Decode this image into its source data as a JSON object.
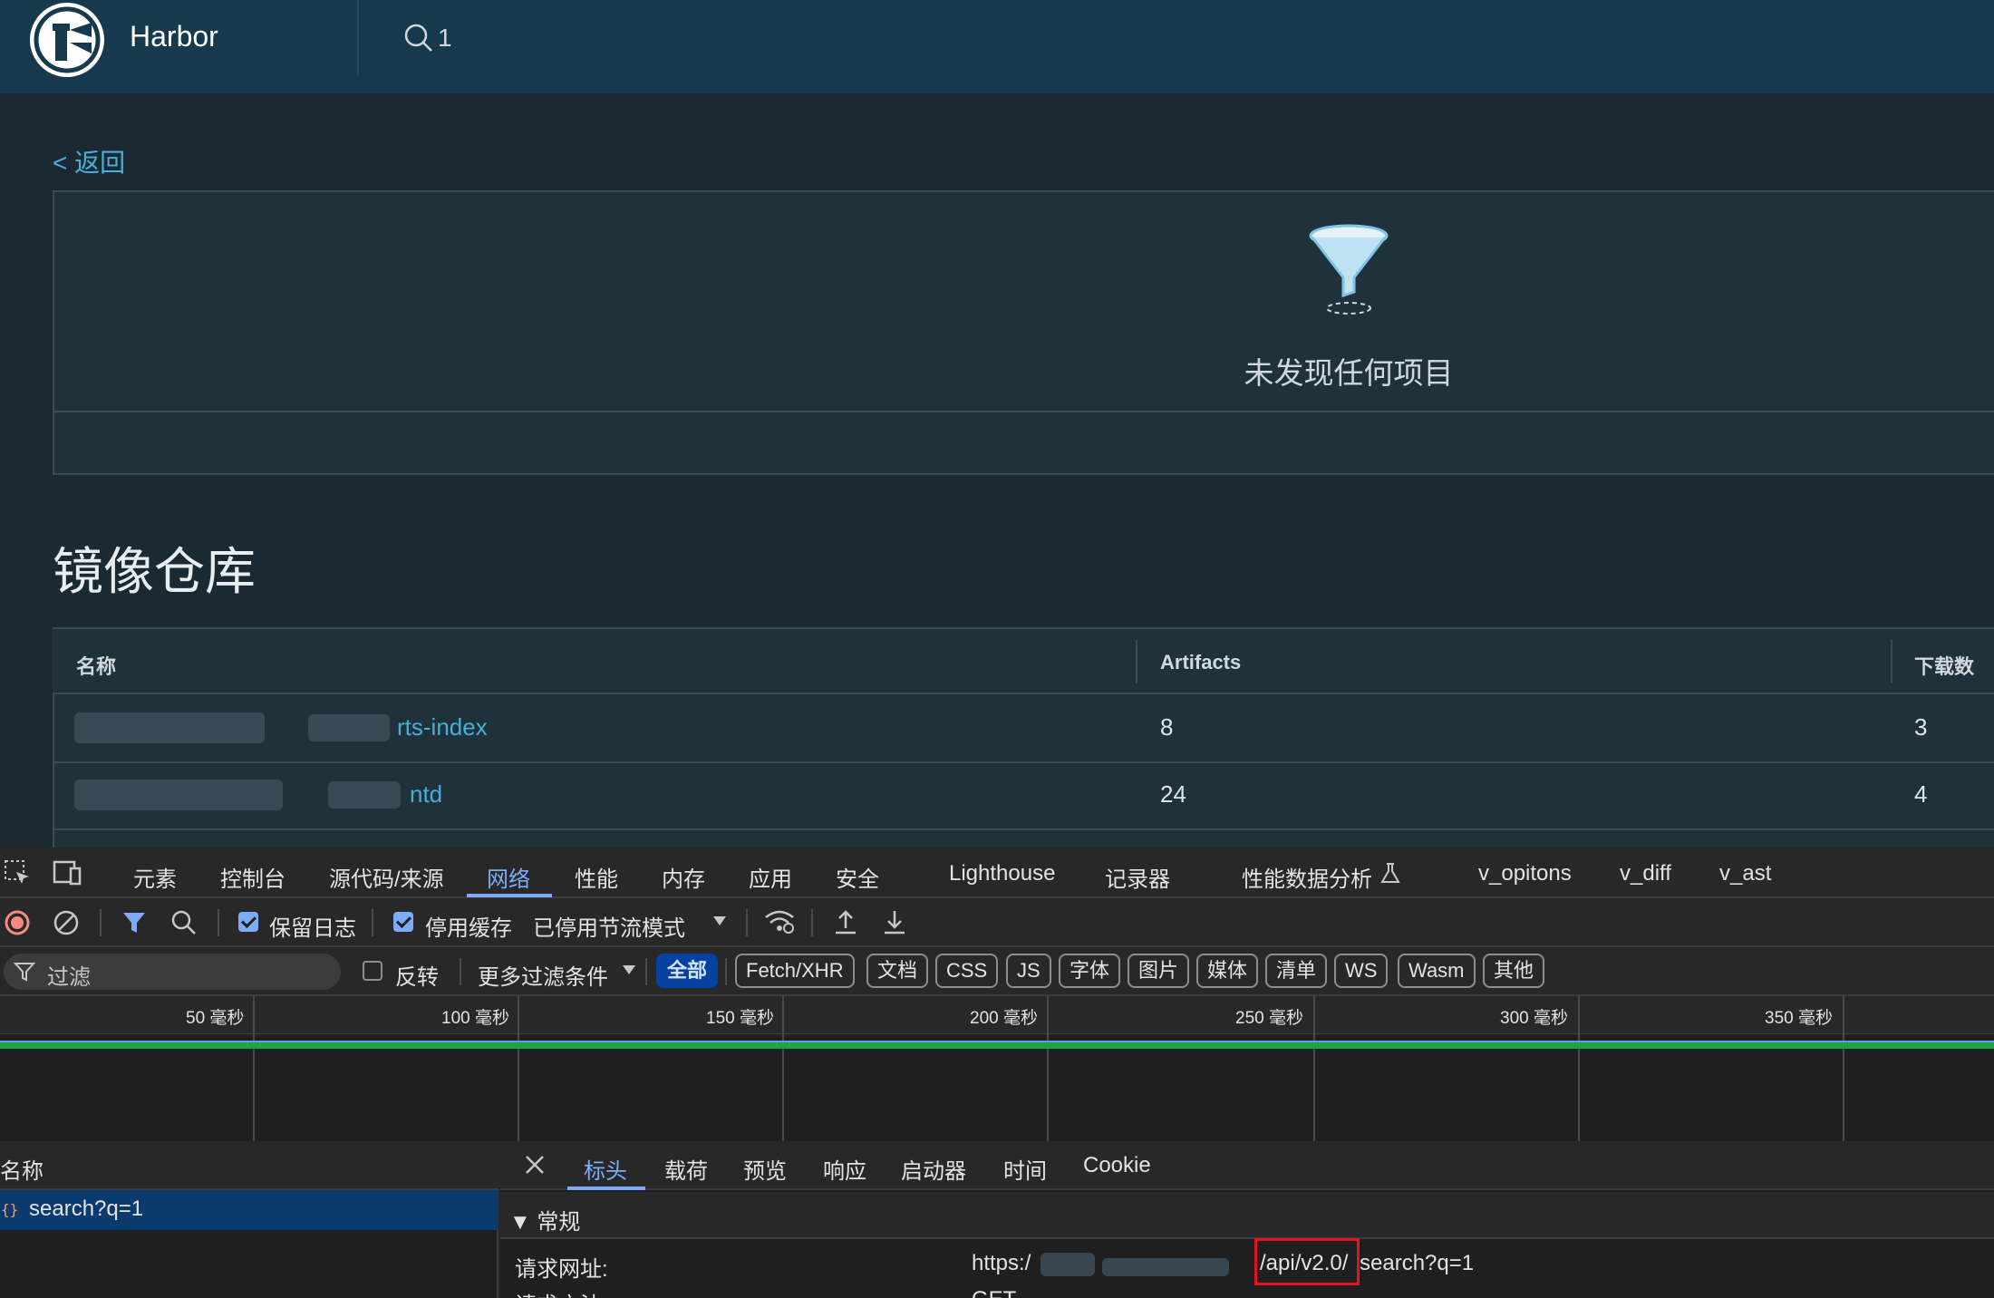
{
  "app": {
    "title": "Harbor",
    "search_query": "1"
  },
  "page": {
    "back_label": "< 返回",
    "empty_state_text": "未发现任何项目",
    "section_title": "镜像仓库",
    "table": {
      "columns": [
        "名称",
        "Artifacts",
        "下载数"
      ],
      "rows": [
        {
          "name": "rts-index",
          "artifacts": "8",
          "downloads": "3"
        },
        {
          "name": "ntd",
          "artifacts": "24",
          "downloads": "4"
        }
      ]
    }
  },
  "devtools": {
    "tabs": [
      "元素",
      "控制台",
      "源代码/来源",
      "网络",
      "性能",
      "内存",
      "应用",
      "安全",
      "Lighthouse",
      "记录器",
      "性能数据分析",
      "v_opitons",
      "v_diff",
      "v_ast"
    ],
    "active_tab": "网络",
    "toolbar": {
      "preserve_log_label": "保留日志",
      "disable_cache_label": "停用缓存",
      "throttle_label": "已停用节流模式"
    },
    "filterbar": {
      "filter_placeholder": "过滤",
      "invert_label": "反转",
      "more_filters_label": "更多过滤条件",
      "chips": [
        "全部",
        "Fetch/XHR",
        "文档",
        "CSS",
        "JS",
        "字体",
        "图片",
        "媒体",
        "清单",
        "WS",
        "Wasm",
        "其他"
      ],
      "active_chip": "全部"
    },
    "timeline": {
      "ticks": [
        "50 毫秒",
        "100 毫秒",
        "150 毫秒",
        "200 毫秒",
        "250 毫秒",
        "300 毫秒",
        "350 毫秒"
      ]
    },
    "requests": {
      "header": "名称",
      "items": [
        {
          "name": "search?q=1"
        }
      ]
    },
    "details": {
      "tabs": [
        "标头",
        "载荷",
        "预览",
        "响应",
        "启动器",
        "时间",
        "Cookie"
      ],
      "active_tab": "标头",
      "general_label": "▼ 常规",
      "request_url_label": "请求网址:",
      "request_url_prefix": "https:/",
      "request_url_highlight": "/api/v2.0/",
      "request_url_suffix": "search?q=1",
      "request_method_label": "请求方法:",
      "request_method_value": "GET"
    }
  },
  "colors": {
    "accent_link": "#49afd9",
    "harbor_header": "#17394d",
    "devtools_accent": "#7cacf8",
    "highlight_box": "#e0141e"
  }
}
